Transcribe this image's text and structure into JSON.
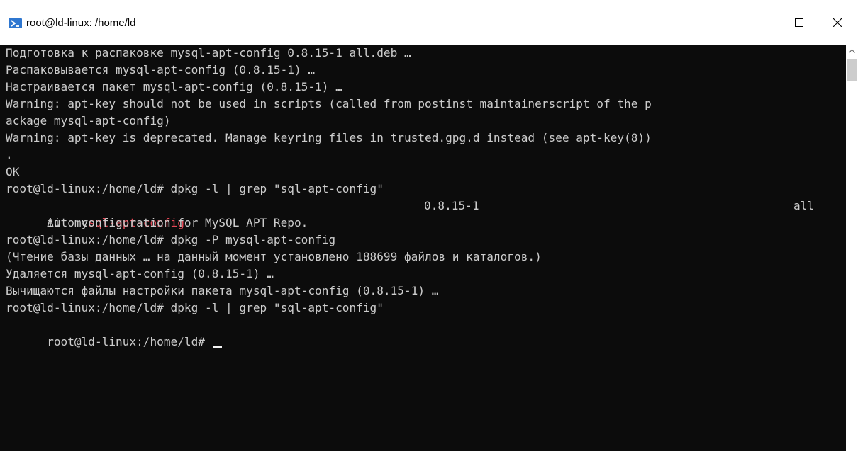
{
  "window": {
    "title": "root@ld-linux: /home/ld",
    "icon": "powershell-icon",
    "controls": [
      "minimize-icon",
      "maximize-icon",
      "close-icon"
    ]
  },
  "terminal": {
    "lines": [
      "Подготовка к распаковке mysql-apt-config_0.8.15-1_all.deb …",
      "Распаковывается mysql-apt-config (0.8.15-1) …",
      "Настраивается пакет mysql-apt-config (0.8.15-1) …",
      "Warning: apt-key should not be used in scripts (called from postinst maintainerscript of the p",
      "ackage mysql-apt-config)",
      "Warning: apt-key is deprecated. Manage keyring files in trusted.gpg.d instead (see apt-key(8))",
      ".",
      "OK",
      "root@ld-linux:/home/ld# dpkg -l | grep \"sql-apt-config\"",
      {
        "prefix": "ii  my",
        "highlight": "sql-apt-config",
        "version": "0.8.15-1",
        "arch": "all"
      },
      "      Auto configuration for MySQL APT Repo.",
      "root@ld-linux:/home/ld# dpkg -P mysql-apt-config",
      "(Чтение базы данных … на данный момент установлено 188699 файлов и каталогов.)",
      "Удаляется mysql-apt-config (0.8.15-1) …",
      "Вычищаются файлы настройки пакета mysql-apt-config (0.8.15-1) …",
      "root@ld-linux:/home/ld# dpkg -l | grep \"sql-apt-config\"",
      "root@ld-linux:/home/ld# "
    ]
  },
  "colors": {
    "background": "#0c0c0c",
    "text": "#cccccc",
    "grep_highlight": "#e74856",
    "title_icon": "#2f77d0"
  }
}
